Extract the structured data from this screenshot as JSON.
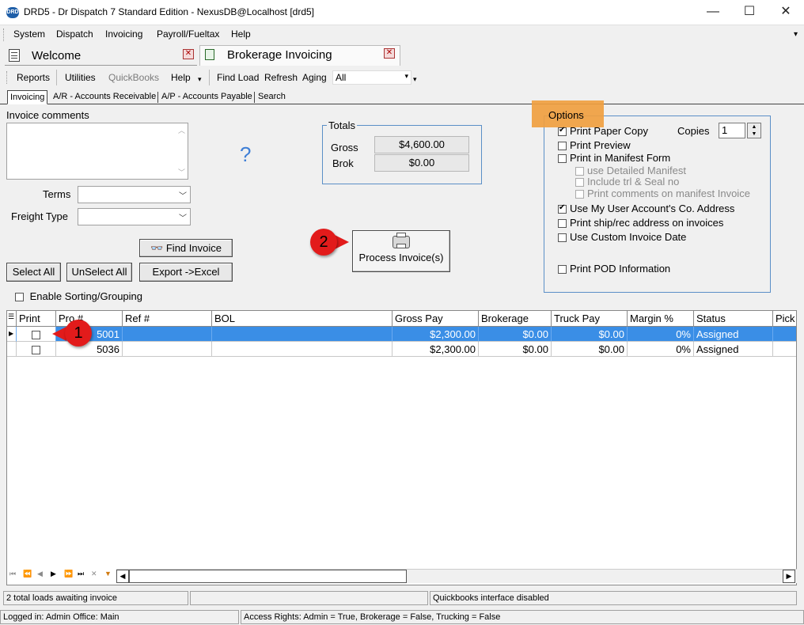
{
  "window": {
    "app_icon_text": "DRD",
    "title": "DRD5 - Dr Dispatch 7 Standard Edition - NexusDB@Localhost [drd5]",
    "minimize": "—",
    "maximize": "☐",
    "close": "✕"
  },
  "menu": {
    "items": [
      "System",
      "Dispatch",
      "Invoicing",
      "Payroll/Fueltax",
      "Help"
    ],
    "overflow": "▾"
  },
  "doc_tabs": [
    {
      "label": "Welcome",
      "close": "✕"
    },
    {
      "label": "Brokerage Invoicing",
      "close": "✕"
    }
  ],
  "toolbar": {
    "reports": "Reports",
    "utilities": "Utilities",
    "quickbooks": "QuickBooks",
    "help": "Help",
    "find_load": "Find Load",
    "refresh": "Refresh",
    "aging": "Aging",
    "filter_value": "All",
    "arrow": "▾"
  },
  "sub_tabs": [
    "Invoicing",
    "A/R - Accounts Receivable",
    "A/P - Accounts Payable",
    "Search"
  ],
  "form": {
    "invoice_comments_label": "Invoice comments",
    "help_mark": "?",
    "terms_label": "Terms",
    "freight_type_label": "Freight Type",
    "find_invoice": "Find Invoice",
    "select_all": "Select All",
    "unselect_all": "UnSelect All",
    "export_excel": "Export ->Excel",
    "enable_sorting": "Enable Sorting/Grouping",
    "process_invoices": "Process Invoice(s)"
  },
  "totals": {
    "title": "Totals",
    "gross_label": "Gross",
    "gross_value": "$4,600.00",
    "brok_label": "Brok",
    "brok_value": "$0.00"
  },
  "options": {
    "title": "Options",
    "print_paper_copy": "Print Paper Copy",
    "copies_label": "Copies",
    "copies_value": "1",
    "print_preview": "Print Preview",
    "print_in_manifest": "Print in Manifest Form",
    "use_detailed_manifest": "use Detailed Manifest",
    "include_trl_seal": "Include trl & Seal no",
    "print_comments_manifest": "Print comments on manifest Invoice",
    "use_user_address": "Use My User Account's Co. Address",
    "print_ship_rec": "Print ship/rec address on invoices",
    "use_custom_date": "Use Custom Invoice Date",
    "print_pod": "Print POD Information",
    "checked": {
      "print_paper_copy": true,
      "use_user_address": true
    }
  },
  "grid": {
    "columns": [
      "Print",
      "Pro #",
      "Ref #",
      "BOL",
      "Gross Pay",
      "Brokerage",
      "Truck Pay",
      "Margin %",
      "Status",
      "Pick"
    ],
    "rows": [
      {
        "pro": "5001",
        "ref": "",
        "bol": "",
        "gross": "$2,300.00",
        "brokerage": "$0.00",
        "truck": "$0.00",
        "margin": "0%",
        "status": "Assigned",
        "selected": true
      },
      {
        "pro": "5036",
        "ref": "",
        "bol": "",
        "gross": "$2,300.00",
        "brokerage": "$0.00",
        "truck": "$0.00",
        "margin": "0%",
        "status": "Assigned",
        "selected": false
      }
    ]
  },
  "nav_buttons": [
    "⏮",
    "⏪",
    "◀",
    "▶",
    "⏩",
    "⏭",
    "✕",
    "▼"
  ],
  "status": {
    "loads_awaiting": "2 total loads awaiting invoice",
    "middle": "",
    "quickbooks": "Quickbooks interface disabled",
    "logged_in": "Logged in: Admin Office: Main",
    "access_rights": "Access Rights: Admin = True, Brokerage = False, Trucking = False"
  },
  "callouts": {
    "one": "1",
    "two": "2"
  },
  "colors": {
    "selected_row": "#3a8ee6",
    "options_highlight": "#f0a040",
    "groupbox_border": "#5b8fc7",
    "callout": "#e21b1b"
  }
}
